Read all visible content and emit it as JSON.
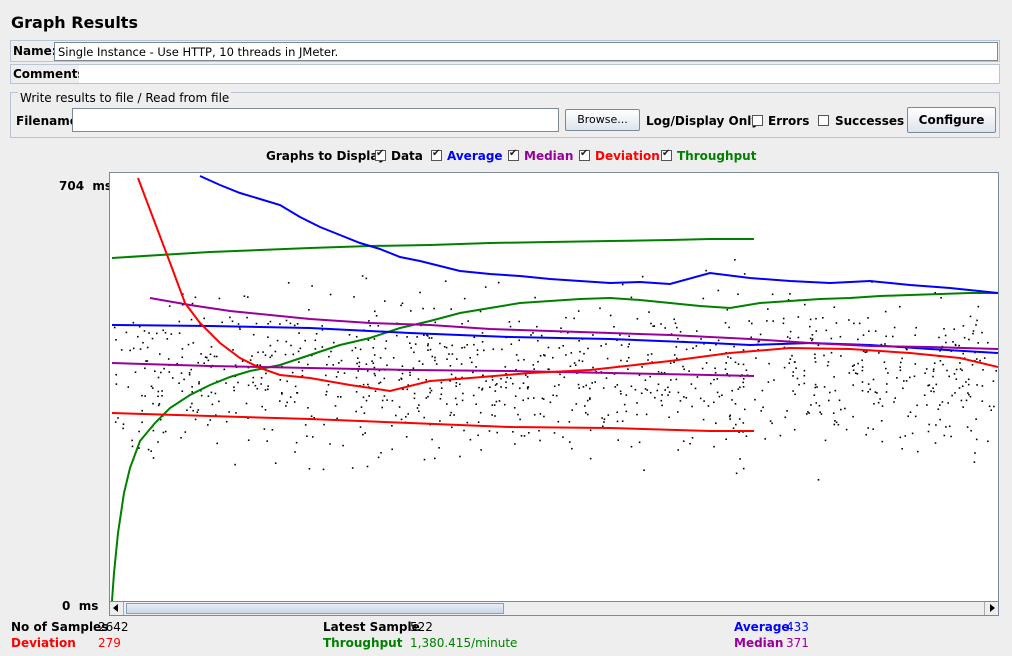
{
  "window_title": "Graph Results",
  "name_field": {
    "label": "Name:",
    "value": "Single Instance - Use HTTP, 10 threads in JMeter."
  },
  "comments_field": {
    "label": "Comments:",
    "value": ""
  },
  "file_group": {
    "legend": "Write results to file / Read from file",
    "filename_label": "Filename",
    "filename_value": "",
    "browse_label": "Browse...",
    "log_display_label": "Log/Display Only:",
    "errors_label": "Errors",
    "errors_checked": false,
    "successes_label": "Successes",
    "successes_checked": false,
    "configure_label": "Configure"
  },
  "graphs_to_display": {
    "label": "Graphs to Display",
    "options": [
      {
        "label": "Data",
        "checked": true,
        "color": "#000000"
      },
      {
        "label": "Average",
        "checked": true,
        "color": "#0000ff"
      },
      {
        "label": "Median",
        "checked": true,
        "color": "#990099"
      },
      {
        "label": "Deviation",
        "checked": true,
        "color": "#ff0000"
      },
      {
        "label": "Throughput",
        "checked": true,
        "color": "#008000"
      }
    ]
  },
  "graph": {
    "y_max_label": "704  ms",
    "y_min_label": "0  ms"
  },
  "colors": {
    "data": "#000000",
    "average": "#0000ff",
    "median": "#990099",
    "deviation": "#ff0000",
    "throughput": "#008000"
  },
  "stats": {
    "samples_label": "No of Samples",
    "samples_value": "2642",
    "latest_label": "Latest Sample",
    "latest_value": "522",
    "average_label": "Average",
    "average_value": "433",
    "deviation_label": "Deviation",
    "deviation_value": "279",
    "throughput_label": "Throughput",
    "throughput_value": "1,380.415/minute",
    "median_label": "Median",
    "median_value": "371"
  }
}
